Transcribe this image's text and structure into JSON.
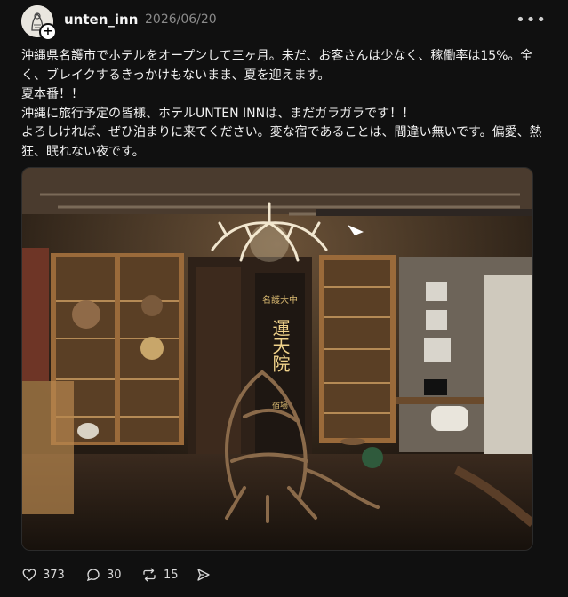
{
  "post": {
    "username": "unten_inn",
    "date": "2026/06/20",
    "more_icon": "ellipsis-icon",
    "paragraphs": [
      "沖縄県名護市でホテルをオープンして三ヶ月。未だ、お客さんは少なく、稼働率は15%。全く、ブレイクするきっかけもないまま、夏を迎えます。",
      "夏本番！！",
      "沖縄に旅行予定の皆様、ホテルUNTEN INNは、まだガラガラです！！",
      "よろしければ、ぜひ泊まりに来てください。変な宿であることは、間違い無いです。偏愛、熱狂、眠れない夜です。"
    ],
    "image": {
      "door_sign_small": "名護大中",
      "door_sign_large": "運天院",
      "door_sign_bottom": "宿場"
    }
  },
  "actions": {
    "likes": "373",
    "replies": "30",
    "reposts": "15"
  },
  "colors": {
    "background": "#101010",
    "text": "#f1f1f1",
    "muted": "#8a8a8a"
  }
}
